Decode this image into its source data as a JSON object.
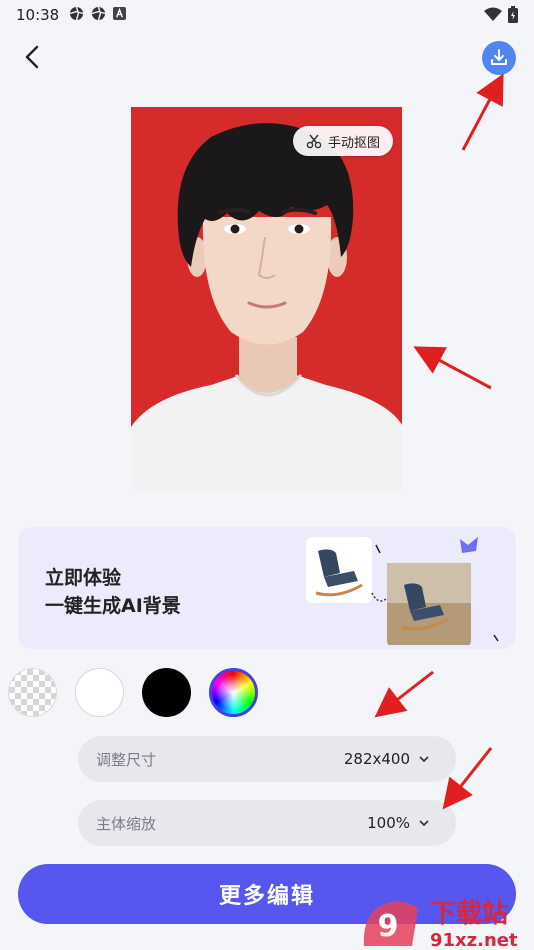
{
  "status_bar": {
    "time": "10:38",
    "icons": [
      "aperture-icon",
      "aperture-icon",
      "a-box-icon"
    ],
    "right_icons": [
      "wifi-icon",
      "battery-icon"
    ]
  },
  "nav": {
    "back_icon": "chevron-left-icon",
    "download_icon": "download-icon"
  },
  "photo": {
    "background_color": "#d52b2b",
    "cutout_label": "手动抠图"
  },
  "banner": {
    "line1": "立即体验",
    "line2": "一键生成AI背景"
  },
  "swatches": [
    {
      "name": "transparent",
      "color": "checker"
    },
    {
      "name": "white",
      "color": "#ffffff"
    },
    {
      "name": "black",
      "color": "#000000"
    },
    {
      "name": "custom",
      "color": "rainbow"
    }
  ],
  "size_select": {
    "label": "调整尺寸",
    "value": "282x400"
  },
  "scale_select": {
    "label": "主体缩放",
    "value": "100%"
  },
  "primary_button": {
    "label": "更多编辑"
  },
  "watermark": {
    "logo_text": "下载站",
    "url_text": "91xz.net"
  },
  "colors": {
    "accent": "#5757f0",
    "download": "#4f86f0",
    "annotation_arrow": "#e02020"
  }
}
